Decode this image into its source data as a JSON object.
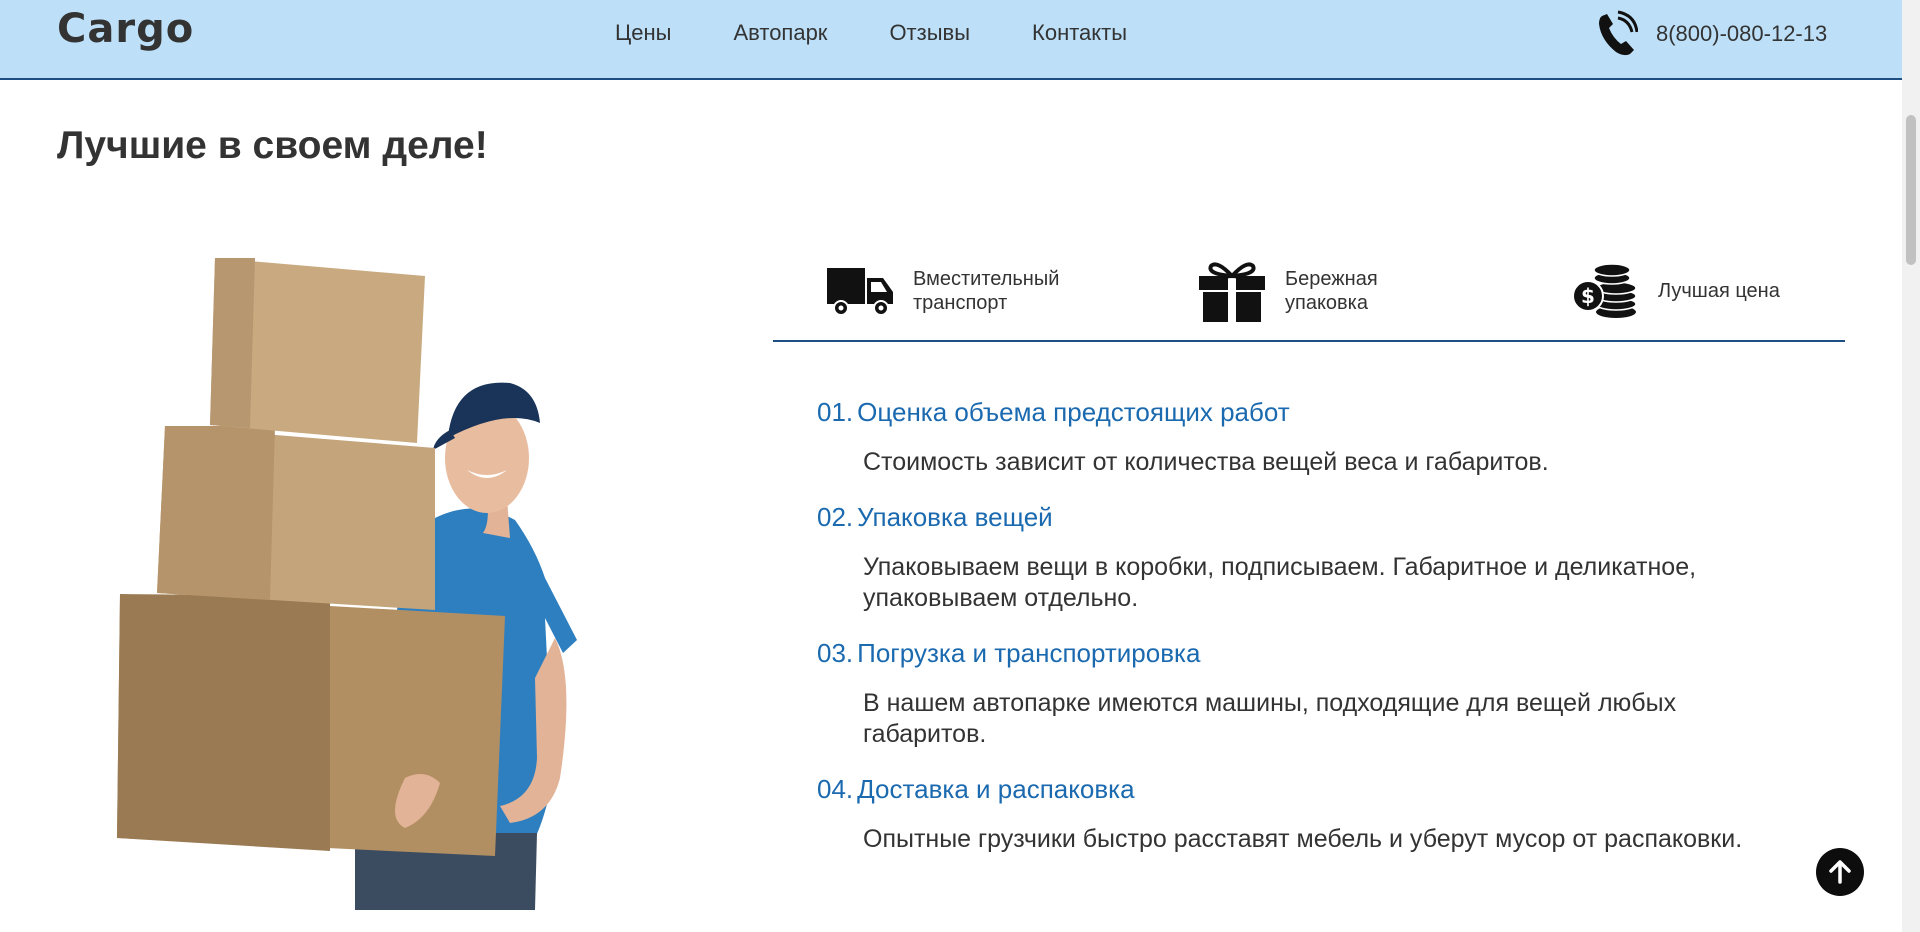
{
  "header": {
    "logo": "Cargo",
    "nav": [
      "Цены",
      "Автопарк",
      "Отзывы",
      "Контакты"
    ],
    "phone": "8(800)-080-12-13"
  },
  "main": {
    "title": "Лучшие в своем деле!",
    "features": [
      {
        "icon": "truck-icon",
        "label_line1": "Вместительный",
        "label_line2": "транспорт"
      },
      {
        "icon": "gift-icon",
        "label_line1": "Бережная",
        "label_line2": "упаковка"
      },
      {
        "icon": "coins-icon",
        "label_line1": "Лучшая цена",
        "label_line2": ""
      }
    ],
    "steps": [
      {
        "num": "01.",
        "title": "Оценка объема предстоящих работ",
        "text": "Стоимость зависит от количества вещей веса и габаритов."
      },
      {
        "num": "02.",
        "title": "Упаковка вещей",
        "text": "Упаковываем вещи в коробки, подписываем. Габаритное и деликатное, упаковываем отдельно."
      },
      {
        "num": "03.",
        "title": "Погрузка и транспортировка",
        "text": "В нашем автопарке имеются машины, подходящие для вещей любых габаритов."
      },
      {
        "num": "04.",
        "title": "Доставка и распаковка",
        "text": "Опытные грузчики быстро расставят мебель и уберут мусор от распаковки."
      }
    ]
  },
  "colors": {
    "header_bg": "#bde0f8",
    "accent_blue": "#1b6ab0",
    "divider": "#1e4f82",
    "text": "#333333"
  }
}
